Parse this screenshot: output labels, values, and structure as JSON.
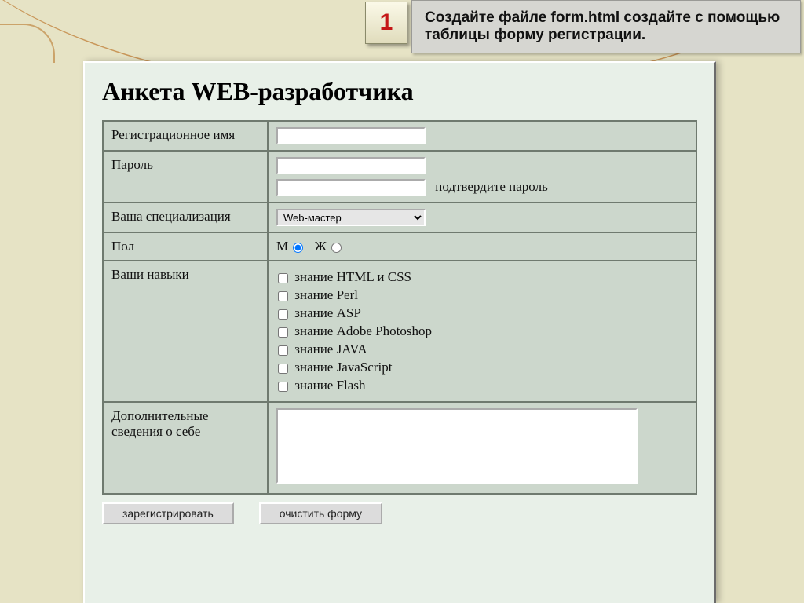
{
  "step_number": "1",
  "instruction_text": "Создайте файле form.html создайте с помощью таблицы форму регистрации.",
  "heading": "Анкета WEB-разработчика",
  "labels": {
    "reg_name": "Регистрационное имя",
    "password": "Пароль",
    "confirm_hint": "подтвердите пароль",
    "specialization": "Ваша специализация",
    "gender": "Пол",
    "skills": "Ваши навыки",
    "notes": "Дополнительные сведения о себе"
  },
  "specialization_selected": "Web-мастер",
  "gender_options": {
    "male": "М",
    "female": "Ж"
  },
  "skills_list": [
    "знание HTML и CSS",
    "знание Perl",
    "знание ASP",
    "знание Adobe Photoshop",
    "знание JAVA",
    "знание JavaScript",
    "знание Flash"
  ],
  "buttons": {
    "submit": "зарегистрировать",
    "reset": "очистить форму"
  }
}
